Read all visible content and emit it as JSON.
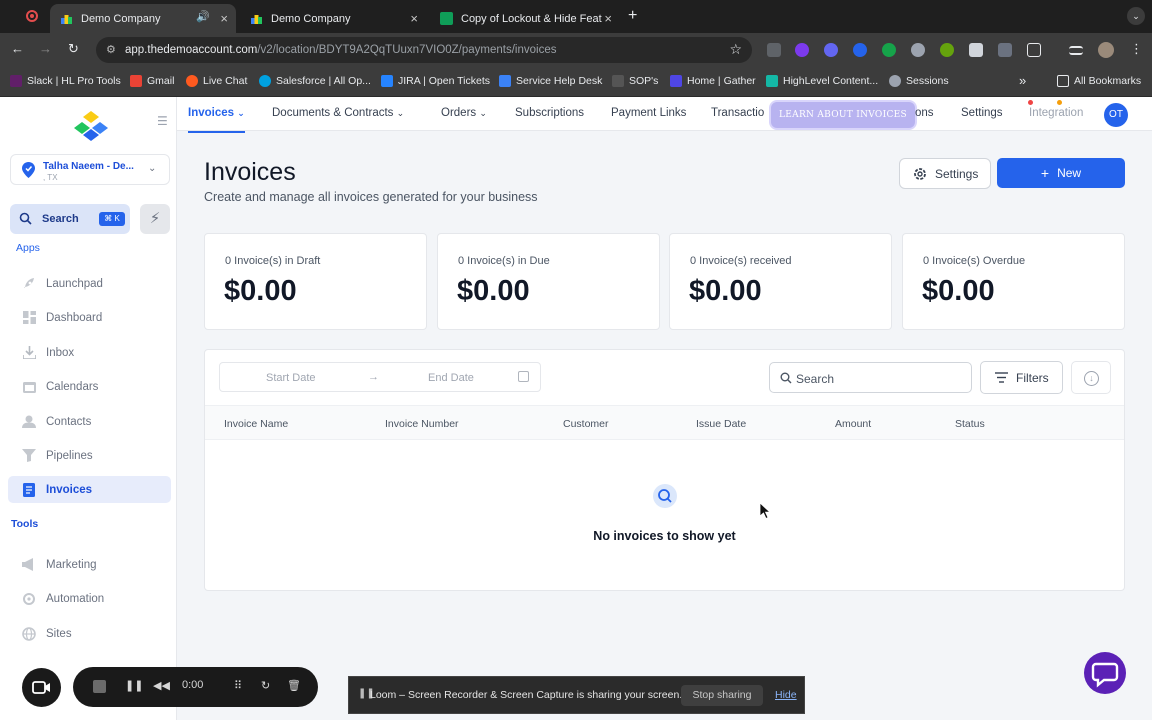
{
  "browser": {
    "tabs": [
      {
        "title": "Demo Company",
        "active": true
      },
      {
        "title": "Demo Company",
        "active": false
      },
      {
        "title": "Copy of Lockout & Hide Feat",
        "active": false
      }
    ],
    "url_host": "app.thedemoaccount.com",
    "url_path": "/v2/location/BDYT9A2QqTUuxn7VIO0Z/payments/invoices",
    "bookmarks": [
      {
        "label": "Slack | HL Pro Tools",
        "color": "#611f69"
      },
      {
        "label": "Gmail",
        "color": "#ea4335"
      },
      {
        "label": "Live Chat",
        "color": "#ff5a1f"
      },
      {
        "label": "Salesforce | All Op...",
        "color": "#00a1e0"
      },
      {
        "label": "JIRA | Open Tickets",
        "color": "#2684ff"
      },
      {
        "label": "Service Help Desk",
        "color": "#3b82f6"
      },
      {
        "label": "SOP's",
        "color": "#555555"
      },
      {
        "label": "Home | Gather",
        "color": "#4f46e5"
      },
      {
        "label": "HighLevel Content...",
        "color": "#14b8a6"
      },
      {
        "label": "Sessions",
        "color": "#9ca3af"
      }
    ],
    "all_bookmarks": "All Bookmarks"
  },
  "sidebar": {
    "location_name": "Talha Naeem - De...",
    "location_sub": ", TX",
    "search_label": "Search",
    "search_shortcut": "⌘ K",
    "apps_label": "Apps",
    "tools_label": "Tools",
    "apps": [
      {
        "label": "Launchpad",
        "icon": "rocket-icon"
      },
      {
        "label": "Dashboard",
        "icon": "dashboard-icon"
      },
      {
        "label": "Inbox",
        "icon": "inbox-icon"
      },
      {
        "label": "Calendars",
        "icon": "calendar-icon"
      },
      {
        "label": "Contacts",
        "icon": "contacts-icon"
      },
      {
        "label": "Pipelines",
        "icon": "pipelines-icon"
      },
      {
        "label": "Invoices",
        "icon": "invoice-icon",
        "active": true
      }
    ],
    "tools": [
      {
        "label": "Marketing",
        "icon": "megaphone-icon"
      },
      {
        "label": "Automation",
        "icon": "automation-icon"
      },
      {
        "label": "Sites",
        "icon": "globe-icon"
      }
    ]
  },
  "topnav": {
    "items": [
      "Invoices",
      "Documents & Contracts",
      "Orders",
      "Subscriptions",
      "Payment Links",
      "Transactio",
      "ons",
      "Settings",
      "Integration"
    ],
    "learn_button": "LEARN ABOUT INVOICES",
    "avatar": "OT"
  },
  "page": {
    "title": "Invoices",
    "subtitle": "Create and manage all invoices generated for your business",
    "settings_label": "Settings",
    "new_label": "New"
  },
  "stats": [
    {
      "label": "0 Invoice(s) in Draft",
      "value": "$0.00"
    },
    {
      "label": "0 Invoice(s) in Due",
      "value": "$0.00"
    },
    {
      "label": "0 Invoice(s) received",
      "value": "$0.00"
    },
    {
      "label": "0 Invoice(s) Overdue",
      "value": "$0.00"
    }
  ],
  "table": {
    "start_date_placeholder": "Start Date",
    "end_date_placeholder": "End Date",
    "search_placeholder": "Search",
    "filters_label": "Filters",
    "columns": [
      "Invoice Name",
      "Invoice Number",
      "Customer",
      "Issue Date",
      "Amount",
      "Status"
    ],
    "empty_message": "No invoices to show yet"
  },
  "loom": {
    "timer": "0:00",
    "share_message": "Loom – Screen Recorder & Screen Capture is sharing your screen.",
    "stop_label": "Stop sharing",
    "hide_label": "Hide"
  },
  "colors": {
    "accent": "#2563eb",
    "brand_purple": "#5b21b6"
  }
}
